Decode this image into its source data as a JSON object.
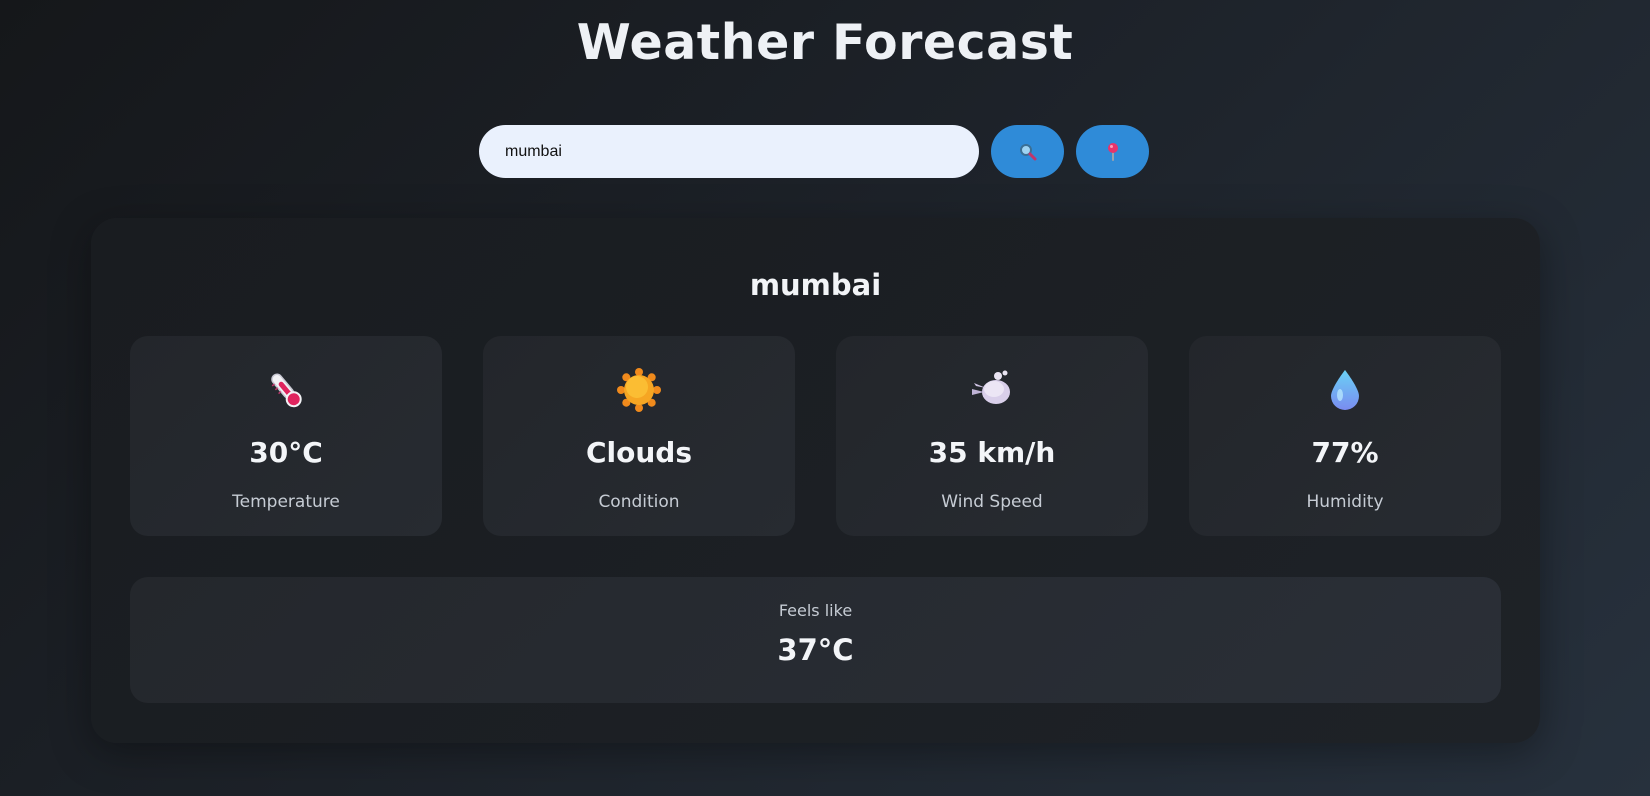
{
  "header": {
    "title": "Weather Forecast"
  },
  "search": {
    "value": "mumbai"
  },
  "buttons": {
    "search_icon": "magnifier-icon",
    "location_icon": "pushpin-icon"
  },
  "weather": {
    "city": "mumbai",
    "stats": [
      {
        "icon": "thermometer-icon",
        "value": "30°C",
        "label": "Temperature"
      },
      {
        "icon": "sun-icon",
        "value": "Clouds",
        "label": "Condition"
      },
      {
        "icon": "wind-icon",
        "value": "35 km/h",
        "label": "Wind Speed"
      },
      {
        "icon": "droplet-icon",
        "value": "77%",
        "label": "Humidity"
      }
    ],
    "feels_like": {
      "label": "Feels like",
      "value": "37°C"
    }
  },
  "colors": {
    "accent": "#2f8bd8",
    "input_bg": "#eaf1fd"
  }
}
